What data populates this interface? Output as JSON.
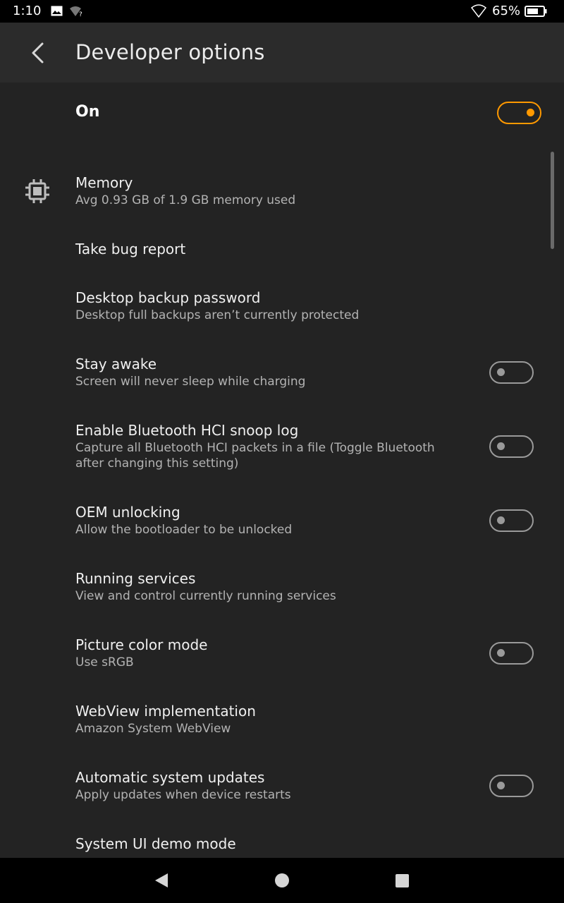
{
  "status_bar": {
    "time": "1:10",
    "battery_percent": "65%",
    "icons": [
      "image-icon",
      "wifi-unknown-icon",
      "wifi-icon",
      "battery-icon"
    ]
  },
  "app_bar": {
    "title": "Developer options",
    "back_icon": "chevron-left-icon"
  },
  "master_switch": {
    "label": "On",
    "state": true,
    "accent_color": "#ff9900"
  },
  "settings": [
    {
      "title": "Memory",
      "subtitle": "Avg 0.93 GB of 1.9 GB memory used",
      "icon": "memory-chip-icon"
    },
    {
      "title": "Take bug report"
    },
    {
      "title": "Desktop backup password",
      "subtitle": "Desktop full backups aren’t currently protected"
    },
    {
      "title": "Stay awake",
      "subtitle": "Screen will never sleep while charging",
      "toggle": false
    },
    {
      "title": "Enable Bluetooth HCI snoop log",
      "subtitle": "Capture all Bluetooth HCI packets in a file (Toggle Bluetooth after changing this setting)",
      "toggle": false
    },
    {
      "title": "OEM unlocking",
      "subtitle": "Allow the bootloader to be unlocked",
      "toggle": false
    },
    {
      "title": "Running services",
      "subtitle": "View and control currently running services"
    },
    {
      "title": "Picture color mode",
      "subtitle": "Use sRGB",
      "toggle": false
    },
    {
      "title": "WebView implementation",
      "subtitle": "Amazon System WebView"
    },
    {
      "title": "Automatic system updates",
      "subtitle": "Apply updates when device restarts",
      "toggle": false
    },
    {
      "title": "System UI demo mode"
    }
  ],
  "nav_bar": {
    "icons": [
      "back-triangle-icon",
      "home-circle-icon",
      "recents-square-icon"
    ]
  }
}
